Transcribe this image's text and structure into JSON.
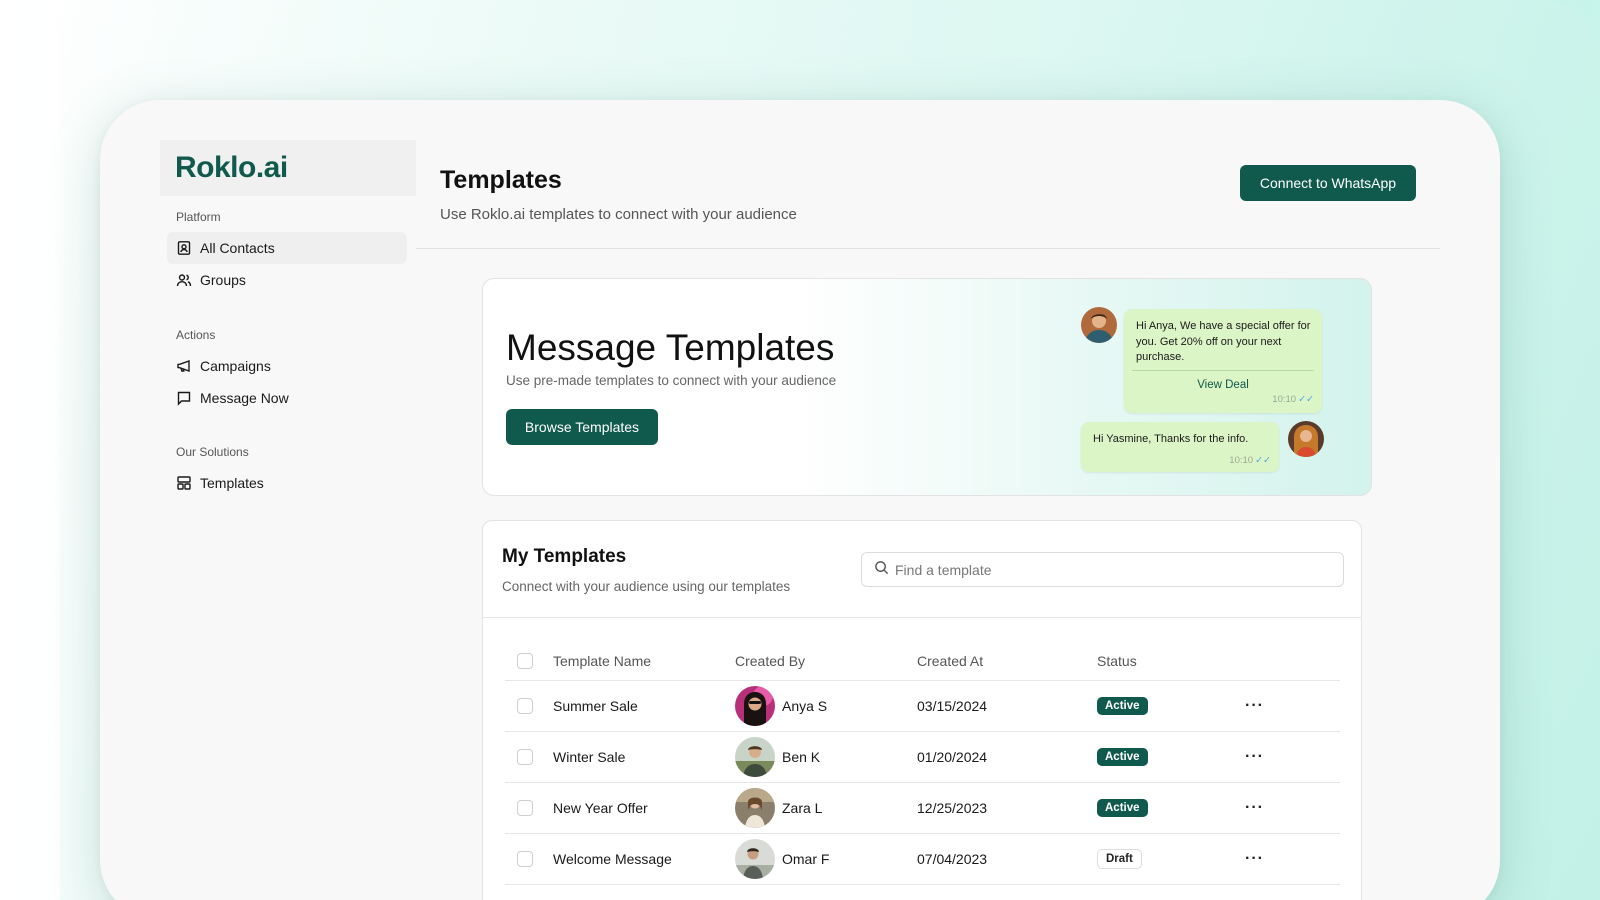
{
  "brand": {
    "logo": "Roklo.ai",
    "accent": "#0f5a4c"
  },
  "sidebar": {
    "sections": [
      {
        "heading": "Platform",
        "items": [
          {
            "label": "All Contacts",
            "icon": "contact-book-icon",
            "active": true
          },
          {
            "label": "Groups",
            "icon": "users-icon",
            "active": false
          }
        ]
      },
      {
        "heading": "Actions",
        "items": [
          {
            "label": "Campaigns",
            "icon": "megaphone-icon",
            "active": false
          },
          {
            "label": "Message Now",
            "icon": "message-square-icon",
            "active": false
          }
        ]
      },
      {
        "heading": "Our Solutions",
        "items": [
          {
            "label": "Templates",
            "icon": "layout-template-icon",
            "active": false
          }
        ]
      }
    ]
  },
  "header": {
    "title": "Templates",
    "subtitle": "Use Roklo.ai templates to connect with your audience",
    "connect_label": "Connect to WhatsApp"
  },
  "hero": {
    "title": "Message Templates",
    "subtitle": "Use pre-made templates to connect with your audience",
    "browse_label": "Browse Templates",
    "chat": [
      {
        "text": "Hi Anya, We have a special offer for you. Get 20% off on your next purchase.",
        "link": "View Deal",
        "time": "10:10",
        "ticks": "✓✓"
      },
      {
        "text": "Hi Yasmine, Thanks for the info.",
        "time": "10:10",
        "ticks": "✓✓"
      }
    ]
  },
  "my_templates": {
    "title": "My Templates",
    "subtitle": "Connect with your audience using our templates",
    "search_placeholder": "Find a template",
    "columns": {
      "name": "Template Name",
      "created_by": "Created By",
      "created_at": "Created At",
      "status": "Status"
    },
    "rows": [
      {
        "name": "Summer Sale",
        "created_by": "Anya S",
        "created_at": "03/15/2024",
        "status": "Active",
        "more": "···"
      },
      {
        "name": "Winter Sale",
        "created_by": "Ben K",
        "created_at": "01/20/2024",
        "status": "Active",
        "more": "···"
      },
      {
        "name": "New Year Offer",
        "created_by": "Zara L",
        "created_at": "12/25/2023",
        "status": "Active",
        "more": "···"
      },
      {
        "name": "Welcome Message",
        "created_by": "Omar F",
        "created_at": "07/04/2023",
        "status": "Draft",
        "more": "···"
      }
    ]
  }
}
